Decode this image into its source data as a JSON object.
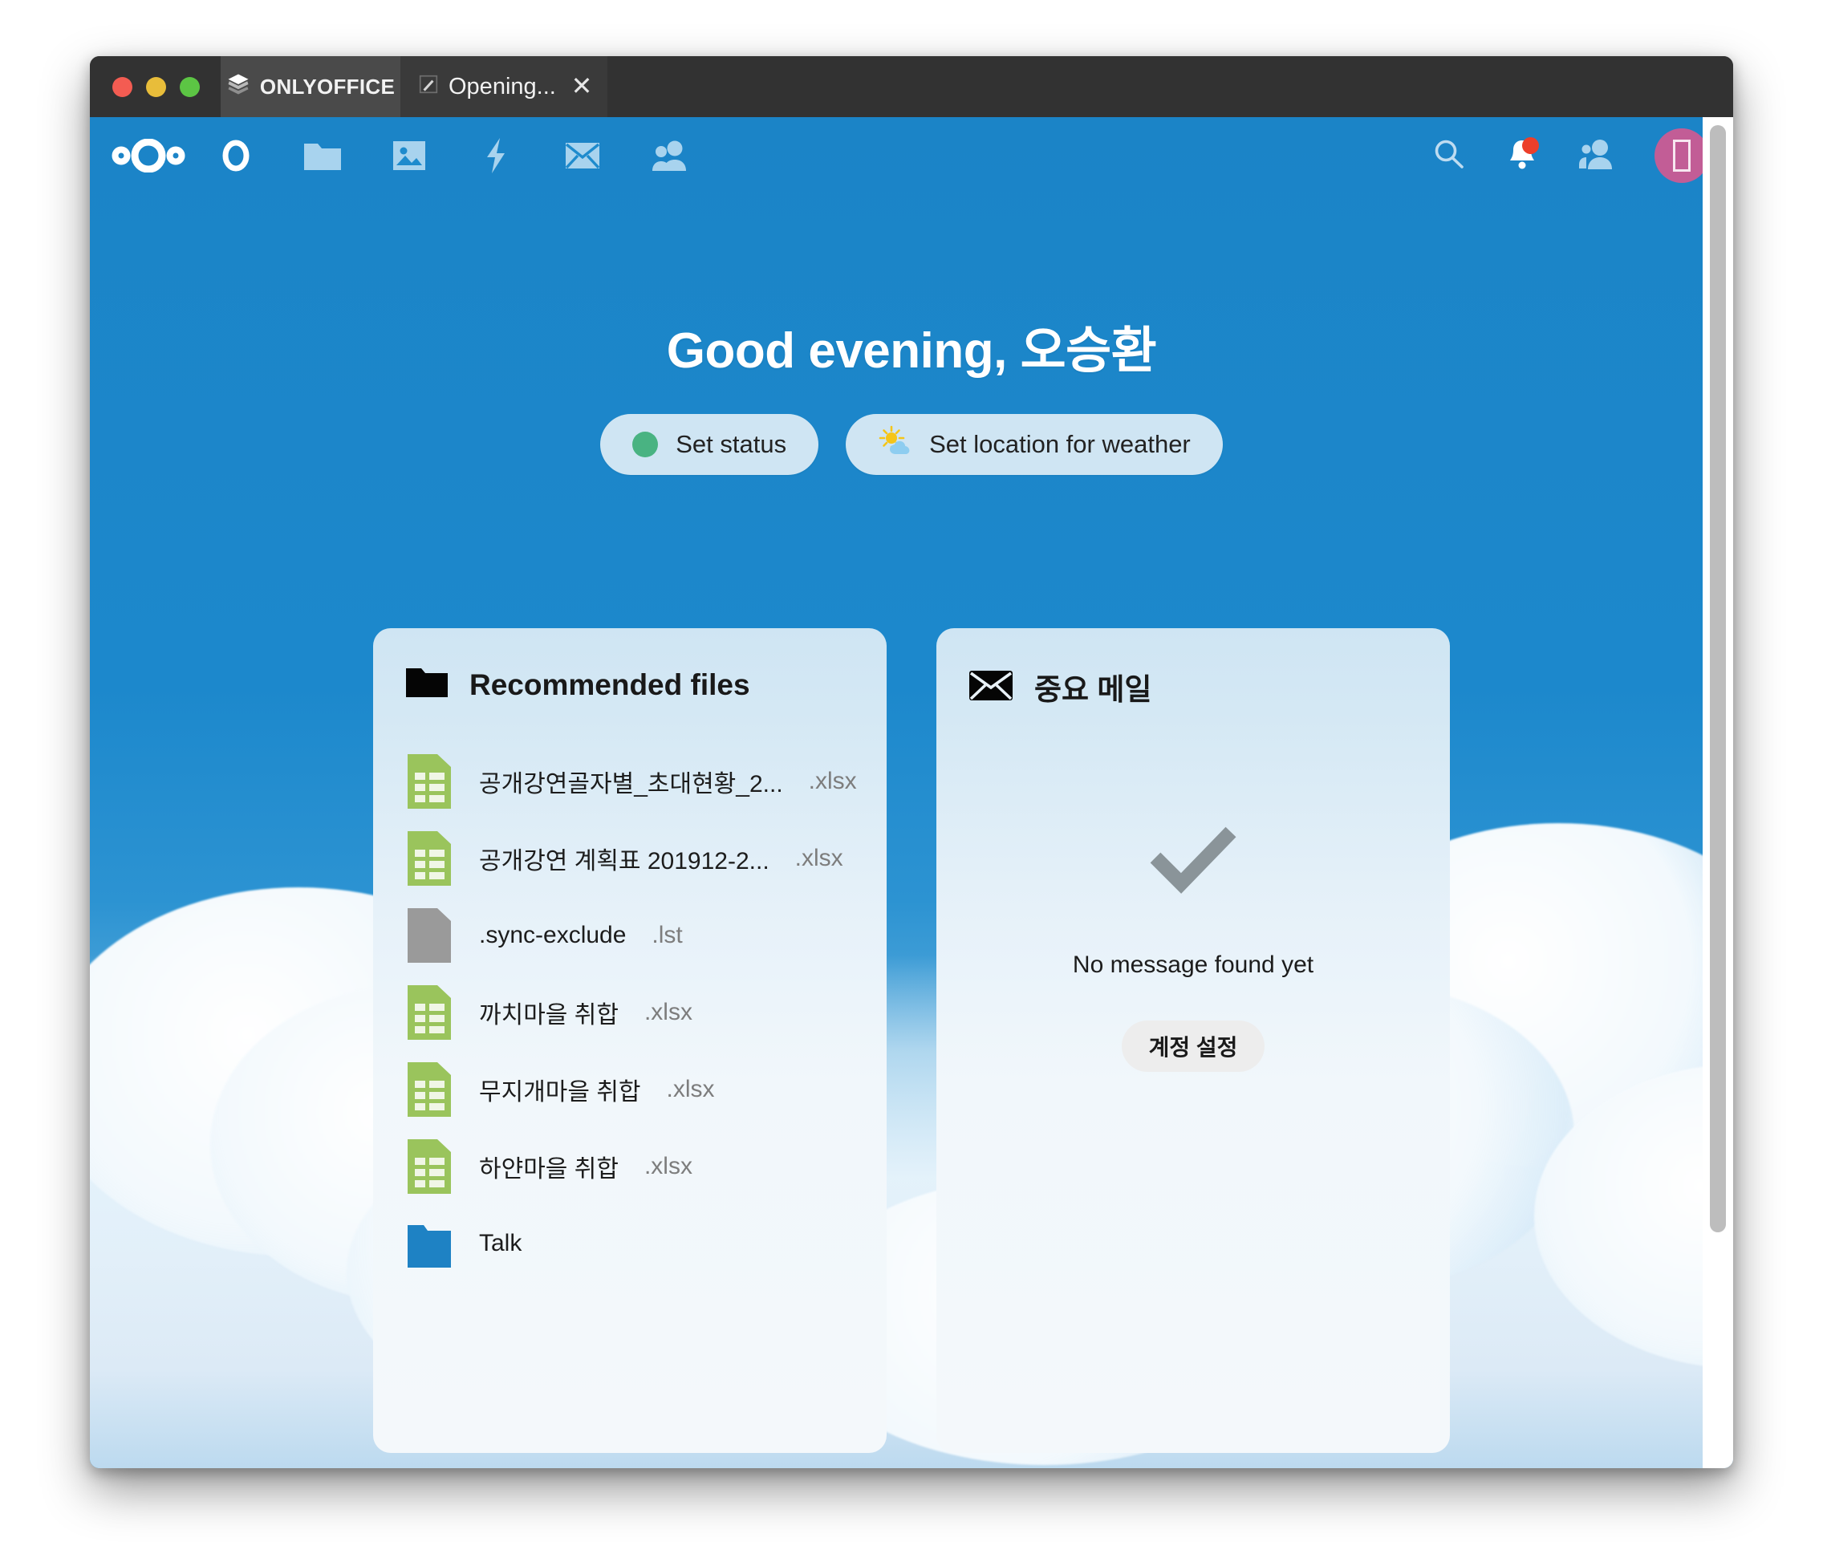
{
  "window": {
    "traffic_lights": [
      "close",
      "minimize",
      "zoom"
    ],
    "tabs": [
      {
        "label": "ONLYOFFICE",
        "icon": "layers-icon",
        "active": true
      },
      {
        "label": "Opening...",
        "icon": "pencil-icon",
        "active": false,
        "close": "✕"
      }
    ]
  },
  "topbar": {
    "logo": "nextcloud-logo",
    "nav_items": [
      {
        "name": "dashboard",
        "icon": "circle-icon"
      },
      {
        "name": "files",
        "icon": "folder-icon"
      },
      {
        "name": "photos",
        "icon": "image-icon"
      },
      {
        "name": "activity",
        "icon": "lightning-icon"
      },
      {
        "name": "mail",
        "icon": "envelope-icon"
      },
      {
        "name": "contacts",
        "icon": "people-icon"
      }
    ],
    "utils": [
      {
        "name": "search",
        "icon": "search-icon"
      },
      {
        "name": "notifications",
        "icon": "bell-icon",
        "badge": true
      },
      {
        "name": "contacts-menu",
        "icon": "contacts-icon"
      }
    ],
    "avatar": {
      "name": "user-avatar",
      "glyph": "▯",
      "color": "#c25d96"
    }
  },
  "dashboard": {
    "greeting": "Good evening, 오승환",
    "status_button": {
      "label": "Set status",
      "dot_color": "#49b382"
    },
    "weather_button": {
      "label": "Set location for weather",
      "icon": "sun-behind-cloud-icon"
    }
  },
  "panels": [
    {
      "id": "recommended-files",
      "title": "Recommended files",
      "icon": "folder-icon",
      "files": [
        {
          "name": "공개강연골자별_초대현황_2...",
          "ext": " .xlsx",
          "icon": "spreadsheet-icon"
        },
        {
          "name": "공개강연 계획표 201912-2...",
          "ext": " .xlsx",
          "icon": "spreadsheet-icon"
        },
        {
          "name": ".sync-exclude",
          "ext": ".lst",
          "icon": "file-icon"
        },
        {
          "name": "까치마을 취합",
          "ext": ".xlsx",
          "icon": "spreadsheet-icon"
        },
        {
          "name": "무지개마을 취합",
          "ext": ".xlsx",
          "icon": "spreadsheet-icon"
        },
        {
          "name": "하얀마을 취합",
          "ext": ".xlsx",
          "icon": "spreadsheet-icon"
        },
        {
          "name": "Talk",
          "ext": "",
          "icon": "folder-blue-icon"
        }
      ]
    },
    {
      "id": "important-mail",
      "title": "중요 메일",
      "icon": "envelope-icon",
      "empty_icon": "check-icon",
      "empty_text": "No message found yet",
      "action_label": "계정 설정"
    }
  ],
  "scrollbar": {
    "name": "vertical-scrollbar"
  }
}
